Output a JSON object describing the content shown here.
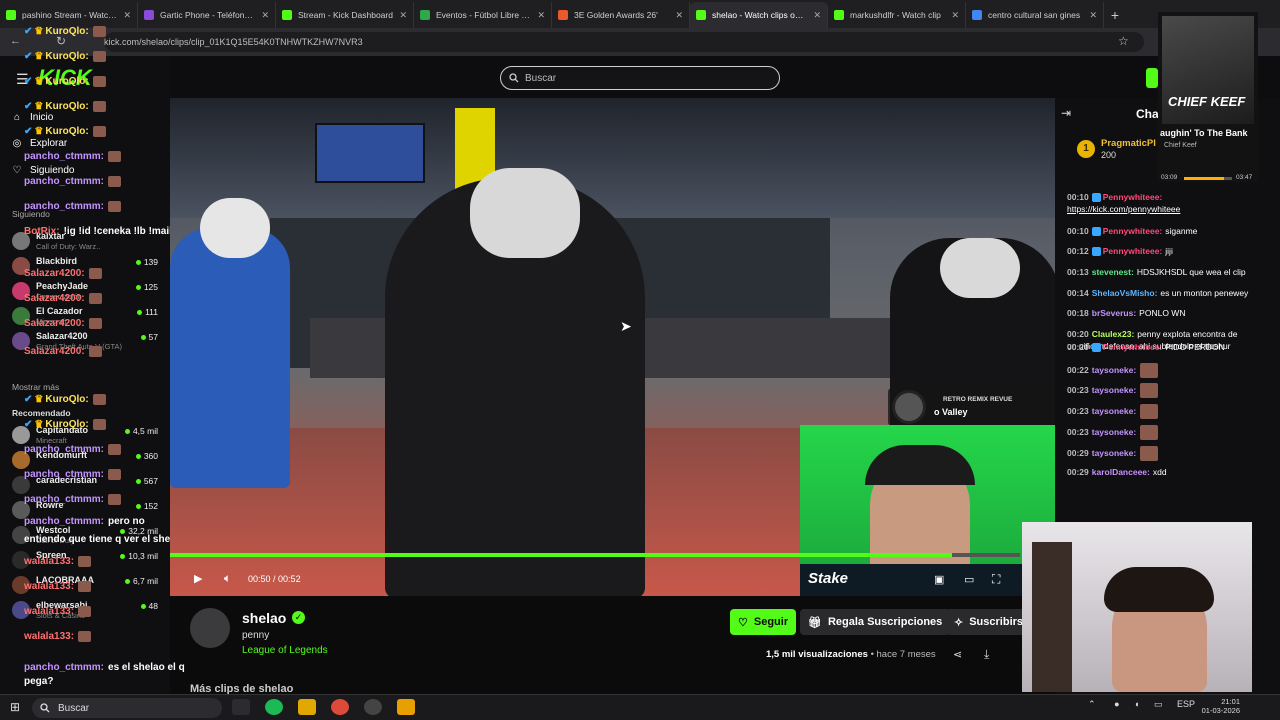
{
  "browser": {
    "tabs": [
      {
        "label": "pashino Stream - Watch L",
        "color": "#53fc18"
      },
      {
        "label": "Gartic Phone - Teléfono D",
        "color": "#8a4bd8"
      },
      {
        "label": "Stream - Kick Dashboard",
        "color": "#53fc18"
      },
      {
        "label": "Eventos - Fútbol Libre TV",
        "color": "#2ea84a"
      },
      {
        "label": "3E Golden Awards 26'",
        "color": "#e85a2b"
      },
      {
        "label": "shelao - Watch clips on K",
        "color": "#53fc18"
      },
      {
        "label": "markushdlfr - Watch clip",
        "color": "#53fc18"
      },
      {
        "label": "centro cultural san gines",
        "color": "#4285f4"
      }
    ],
    "active_tab": 5,
    "url": "kick.com/shelao/clips/clip_01K1Q15E54K0TNHWTKZHW7NVR3"
  },
  "kick": {
    "logo": "KICK",
    "search_placeholder": "Buscar",
    "nav": [
      {
        "label": "Inicio",
        "icon": "home-icon"
      },
      {
        "label": "Explorar",
        "icon": "compass-icon"
      },
      {
        "label": "Siguiendo",
        "icon": "heart-icon"
      }
    ],
    "section_following": "Siguiendo",
    "section_recommended": "Recomendado",
    "show_more": "Mostrar más",
    "following": [
      {
        "name": "kaixtar",
        "game": "Call of Duty: Warz..",
        "viewers": "",
        "color": "#777"
      },
      {
        "name": "Blackbird",
        "game": "",
        "viewers": "139",
        "color": "#8a4b44"
      },
      {
        "name": "PeachyJade",
        "game": "Conversación",
        "viewers": "125",
        "color": "#c73a6b"
      },
      {
        "name": "El Cazador",
        "game": "Minecraft",
        "viewers": "111",
        "color": "#3a7a3a"
      },
      {
        "name": "Salazar4200",
        "game": "Grand Theft Auto V (GTA)",
        "viewers": "57",
        "color": "#6a4b8a"
      }
    ],
    "recommended": [
      {
        "name": "Capitandato",
        "game": "Minecraft",
        "viewers": "4,5 mil",
        "color": "#999"
      },
      {
        "name": "Kendomurft",
        "game": "",
        "viewers": "360",
        "color": "#a86a2b"
      },
      {
        "name": "caradecristian",
        "game": "",
        "viewers": "567",
        "color": "#3a3a3a"
      },
      {
        "name": "Rowre",
        "game": "",
        "viewers": "152",
        "color": "#5a5a5a"
      },
      {
        "name": "Westcol",
        "game": "Call of Duty",
        "viewers": "32,2 mil",
        "color": "#444"
      },
      {
        "name": "Spreen",
        "game": "",
        "viewers": "10,3 mil",
        "color": "#2a2a2a"
      },
      {
        "name": "LACOBRAAA",
        "game": "",
        "viewers": "6,7 mil",
        "color": "#6a3a2a"
      },
      {
        "name": "elbewarsabi",
        "game": "Slots & Casino",
        "viewers": "48",
        "color": "#4a4a8a"
      }
    ]
  },
  "overlay_chat": [
    {
      "user": "KuroQlo:",
      "msg": "",
      "cls": "u1",
      "badge": "crown"
    },
    {
      "user": "KuroQlo:",
      "msg": "",
      "cls": "u1",
      "badge": "crown"
    },
    {
      "user": "KuroQlo:",
      "msg": "",
      "cls": "u1",
      "badge": "crown"
    },
    {
      "user": "KuroQlo:",
      "msg": "",
      "cls": "u1",
      "badge": "crown"
    },
    {
      "user": "KuroQlo:",
      "msg": "",
      "cls": "u1",
      "badge": "crown"
    },
    {
      "user": "pancho_ctmmm:",
      "msg": "",
      "cls": "u2",
      "badge": ""
    },
    {
      "user": "pancho_ctmmm:",
      "msg": "",
      "cls": "u2",
      "badge": ""
    },
    {
      "user": "pancho_ctmmm:",
      "msg": "",
      "cls": "u2",
      "badge": ""
    },
    {
      "user": "BotRix:",
      "msg": "!ig !id !ceneka !lb !mail",
      "cls": "u3",
      "badge": ""
    },
    {
      "user": "Salazar4200:",
      "msg": "",
      "cls": "u3",
      "badge": ""
    },
    {
      "user": "Salazar4200:",
      "msg": "",
      "cls": "u3",
      "badge": ""
    },
    {
      "user": "Salazar4200:",
      "msg": "",
      "cls": "u3",
      "badge": ""
    },
    {
      "user": "Salazar4200:",
      "msg": "",
      "cls": "u3",
      "badge": ""
    },
    {
      "user": "KuroQlo:",
      "msg": "",
      "cls": "u1",
      "badge": "crown"
    },
    {
      "user": "KuroQlo:",
      "msg": "",
      "cls": "u1",
      "badge": "crown"
    },
    {
      "user": "pancho_ctmmm:",
      "msg": "",
      "cls": "u2",
      "badge": ""
    },
    {
      "user": "pancho_ctmmm:",
      "msg": "",
      "cls": "u2",
      "badge": ""
    },
    {
      "user": "pancho_ctmmm:",
      "msg": "",
      "cls": "u2",
      "badge": ""
    },
    {
      "user": "pancho_ctmmm:",
      "msg": "pero no",
      "cls": "u2",
      "badge": ""
    },
    {
      "user": "",
      "msg": "entiendo que tiene q ver el shelao",
      "cls": "u2",
      "badge": ""
    },
    {
      "user": "walala133:",
      "msg": "",
      "cls": "u3",
      "badge": ""
    },
    {
      "user": "walala133:",
      "msg": "",
      "cls": "u3",
      "badge": ""
    },
    {
      "user": "walala133:",
      "msg": "",
      "cls": "u3",
      "badge": ""
    },
    {
      "user": "walala133:",
      "msg": "",
      "cls": "u3",
      "badge": ""
    },
    {
      "user": "pancho_ctmmm:",
      "msg": "es el shelao el q",
      "cls": "u2",
      "badge": ""
    },
    {
      "user": "",
      "msg": "pega?",
      "cls": "u2",
      "badge": ""
    }
  ],
  "video": {
    "time_current": "00:50",
    "time_total": "00:52",
    "progress": 0.92,
    "music_channel": "RETRO REMIX REVUE",
    "music_title": "o Valley",
    "sponsor": "Stake"
  },
  "channel": {
    "name": "shelao",
    "clip_title": "penny",
    "category": "League of Legends",
    "follow_label": "Seguir",
    "gift_label": "Regala Suscripciones",
    "subscribe_label": "Suscribirs",
    "views": "1,5 mil visualizaciones",
    "ago": "• hace 7 meses",
    "more_clips": "Más clips de shelao"
  },
  "chat": {
    "title": "Cha",
    "pinned_name": "PragmaticPl",
    "pinned_count": "200",
    "messages": [
      {
        "time": "00:10",
        "user": "Pennywhiteee:",
        "text": "",
        "color": "#ff4a7a",
        "badge": true
      },
      {
        "time": "",
        "user": "",
        "text": "https://kick.com/pennywhiteee",
        "color": "#fff",
        "badge": false,
        "link": true
      },
      {
        "time": "00:10",
        "user": "Pennywhiteee:",
        "text": "siganme",
        "color": "#ff4a7a",
        "badge": true
      },
      {
        "time": "00:12",
        "user": "Pennywhiteee:",
        "text": "jiji",
        "color": "#ff4a7a",
        "badge": true
      },
      {
        "time": "00:13",
        "user": "stevenest:",
        "text": "HDSJKHSDL que wea el clip",
        "color": "#5ee88a",
        "badge": false
      },
      {
        "time": "00:14",
        "user": "ShelaoVsMisho:",
        "text": "es un monton penewey",
        "color": "#5eb6ff",
        "badge": false
      },
      {
        "time": "00:18",
        "user": "brSeverus:",
        "text": "PONLO WN",
        "color": "#c494ff",
        "badge": false
      },
      {
        "time": "00:20",
        "user": "Claulex23:",
        "text": "penny explota encontra de",
        "color": "#b8ff5e",
        "badge": false
      },
      {
        "time": "",
        "user": "",
        "text": "un niño indefenso. ahi subiendolo el tioshur",
        "color": "#fff",
        "badge": false
      },
      {
        "time": "00:20",
        "user": "Pennywhiteee:",
        "text": "PIDO PERDON",
        "color": "#ff4a7a",
        "badge": true
      },
      {
        "time": "00:22",
        "user": "taysoneke:",
        "text": "",
        "color": "#c494ff",
        "badge": false,
        "emote": true
      },
      {
        "time": "00:23",
        "user": "taysoneke:",
        "text": "",
        "color": "#c494ff",
        "badge": false,
        "emote": true
      },
      {
        "time": "00:23",
        "user": "taysoneke:",
        "text": "",
        "color": "#c494ff",
        "badge": false,
        "emote": true
      },
      {
        "time": "00:23",
        "user": "taysoneke:",
        "text": "",
        "color": "#c494ff",
        "badge": false,
        "emote": true
      },
      {
        "time": "00:29",
        "user": "taysoneke:",
        "text": "",
        "color": "#c494ff",
        "badge": false,
        "emote": true
      },
      {
        "time": "00:29",
        "user": "karolDanceee:",
        "text": "xdd",
        "color": "#c494ff",
        "badge": false
      }
    ]
  },
  "music_widget": {
    "artist_art": "CHIEF KEEF",
    "song": "aughin' To The Bank",
    "artist": "Chief Keef",
    "elapsed": "03:09",
    "total": "03:47"
  },
  "taskbar": {
    "search": "Buscar",
    "lang": "ESP",
    "time": "21:01",
    "date": "01-03-2026"
  }
}
